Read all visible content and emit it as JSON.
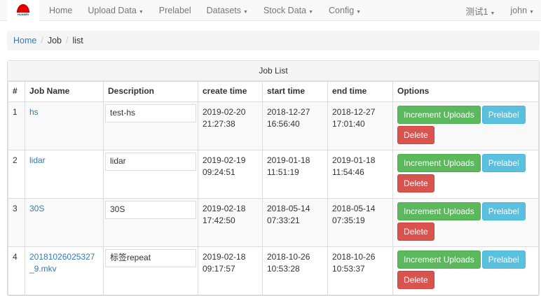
{
  "nav": {
    "logo_text": "HUAWEI",
    "items": [
      {
        "label": "Home",
        "dropdown": false
      },
      {
        "label": "Upload Data",
        "dropdown": true
      },
      {
        "label": "Prelabel",
        "dropdown": false
      },
      {
        "label": "Datasets",
        "dropdown": true
      },
      {
        "label": "Stock Data",
        "dropdown": true
      },
      {
        "label": "Config",
        "dropdown": true
      }
    ],
    "project": "测试1",
    "user": "john"
  },
  "breadcrumb": [
    "Home",
    "Job",
    "list"
  ],
  "panel": {
    "title": "Job List"
  },
  "table": {
    "headers": [
      "#",
      "Job Name",
      "Description",
      "create time",
      "start time",
      "end time",
      "Options"
    ],
    "rows": [
      {
        "id": "1",
        "name": "hs",
        "desc": "test-hs",
        "create": [
          "2019-02-20",
          "21:27:38"
        ],
        "start": [
          "2018-12-27",
          "16:56:40"
        ],
        "end": [
          "2018-12-27",
          "17:01:40"
        ]
      },
      {
        "id": "2",
        "name": "lidar",
        "desc": "lidar",
        "create": [
          "2019-02-19",
          "09:24:51"
        ],
        "start": [
          "2019-01-18",
          "11:51:19"
        ],
        "end": [
          "2019-01-18",
          "11:54:46"
        ]
      },
      {
        "id": "3",
        "name": "30S",
        "desc": "30S",
        "create": [
          "2019-02-18",
          "17:42:50"
        ],
        "start": [
          "2018-05-14",
          "07:33:21"
        ],
        "end": [
          "2018-05-14",
          "07:35:19"
        ]
      },
      {
        "id": "4",
        "name": "20181026025327_9.mkv",
        "desc": "标签repeat",
        "create": [
          "2019-02-18",
          "09:17:57"
        ],
        "start": [
          "2018-10-26",
          "10:53:28"
        ],
        "end": [
          "2018-10-26",
          "10:53:37"
        ]
      }
    ],
    "buttons": {
      "increment": "Increment Uploads",
      "prelabel": "Prelabel",
      "delete": "Delete"
    }
  }
}
